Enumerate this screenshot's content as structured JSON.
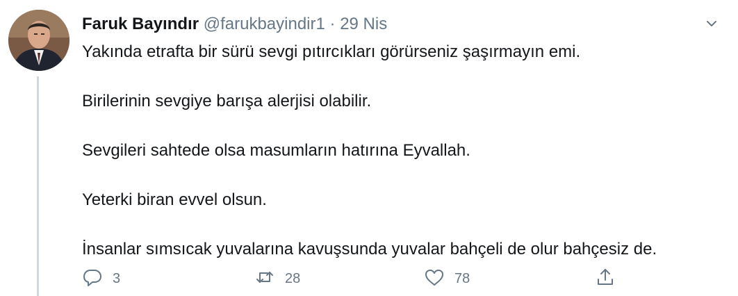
{
  "tweet": {
    "author_name": "Faruk Bayındır",
    "handle": "@farukbayindir1",
    "separator": "·",
    "date": "29 Nis",
    "lines": [
      "Yakında etrafta bir sürü sevgi pıtırcıkları görürseniz şaşırmayın emi.",
      "Birilerinin sevgiye barışa alerjisi olabilir.",
      "Sevgileri sahtede olsa masumların hatırına Eyvallah.",
      "Yeterki biran evvel olsun.",
      "İnsanlar sımsıcak yuvalarına kavuşsunda yuvalar bahçeli de olur bahçesiz de."
    ],
    "actions": {
      "reply_count": "3",
      "retweet_count": "28",
      "like_count": "78"
    }
  },
  "icons": {
    "menu": "chevron-down-icon",
    "reply": "reply-icon",
    "retweet": "retweet-icon",
    "like": "heart-icon",
    "share": "share-icon"
  },
  "colors": {
    "text": "#14171a",
    "secondary": "#657786",
    "thread_line": "#cfd9de"
  }
}
